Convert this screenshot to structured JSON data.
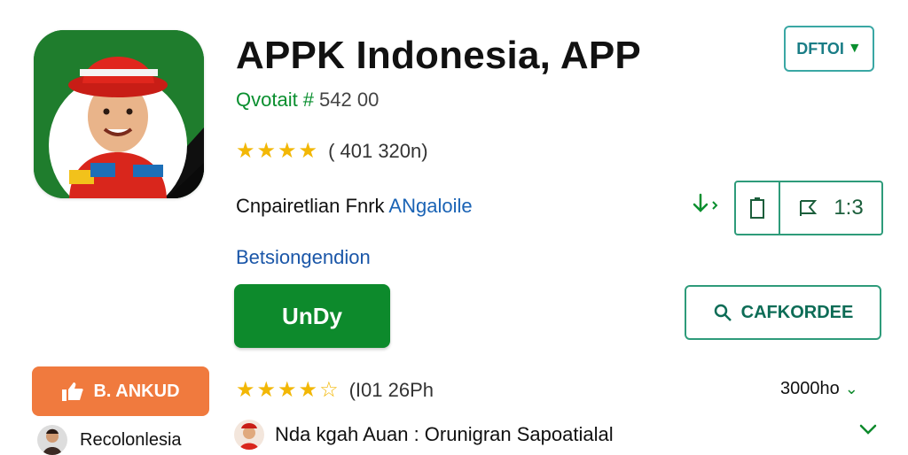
{
  "header": {
    "app_title": "APPK Indonesia, APP",
    "developer": "Qvotait #",
    "developer_code": "542 00",
    "install_top_label": "DFTOI"
  },
  "rating": {
    "stars": "★★★★",
    "count": "( 401 320n)"
  },
  "category": {
    "prefix": "Cnpairetlian Fnrk",
    "name": "ANgaloile"
  },
  "release_link": "Betsiongendion",
  "meta": {
    "download_icon": "download-icon",
    "size": "1:3"
  },
  "install_button": "UnDy",
  "search_button": "CAFKORDEE",
  "recommend_button": "B. ANKUD",
  "rating2": {
    "stars": "★★★★",
    "star_empty": "☆",
    "count": "(I01 26Ph"
  },
  "downloads": "3000ho",
  "reviewers": {
    "left_name": "Recolonlesia",
    "right_text": "Nda kgah Auan : Orunigran Sapoatialal"
  },
  "colors": {
    "primary_green": "#0d8a2c",
    "teal_border": "#2e9b7a",
    "orange": "#f07a3e",
    "star": "#f2b705",
    "link_blue": "#1a56a8"
  }
}
